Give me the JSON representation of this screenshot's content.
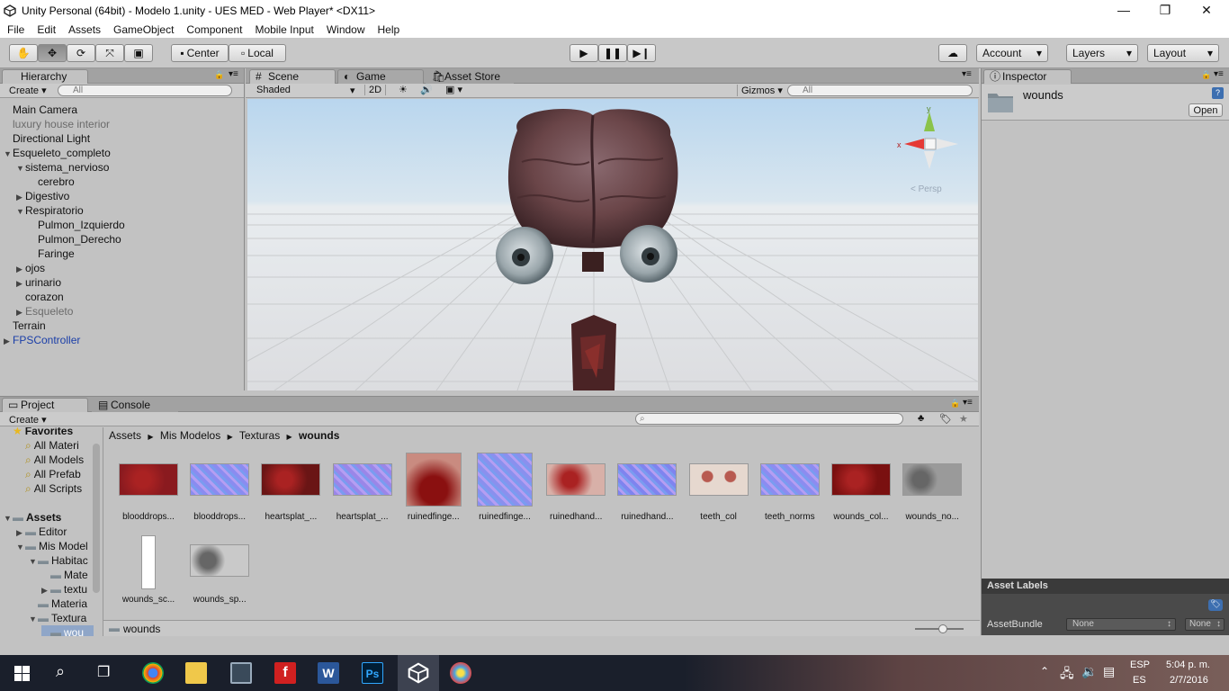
{
  "window": {
    "title": "Unity Personal (64bit) - Modelo 1.unity - UES MED - Web Player* <DX11>",
    "minimize": "—",
    "restore": "❐",
    "close": "✕"
  },
  "menu": [
    "File",
    "Edit",
    "Assets",
    "GameObject",
    "Component",
    "Mobile Input",
    "Window",
    "Help"
  ],
  "toolbar": {
    "center": "Center",
    "local": "Local",
    "account": "Account",
    "layers": "Layers",
    "layout": "Layout"
  },
  "hierarchy": {
    "tab": "Hierarchy",
    "create": "Create",
    "search_placeholder": "All",
    "items": [
      {
        "label": "Main Camera",
        "indent": 0,
        "arrow": "",
        "style": ""
      },
      {
        "label": "luxury house interior",
        "indent": 0,
        "arrow": "",
        "style": "grey"
      },
      {
        "label": "Directional Light",
        "indent": 0,
        "arrow": "",
        "style": ""
      },
      {
        "label": "Esqueleto_completo",
        "indent": 0,
        "arrow": "▼",
        "style": ""
      },
      {
        "label": "sistema_nervioso",
        "indent": 1,
        "arrow": "▼",
        "style": ""
      },
      {
        "label": "cerebro",
        "indent": 2,
        "arrow": "",
        "style": ""
      },
      {
        "label": "Digestivo",
        "indent": 1,
        "arrow": "▶",
        "style": ""
      },
      {
        "label": "Respiratorio",
        "indent": 1,
        "arrow": "▼",
        "style": ""
      },
      {
        "label": "Pulmon_Izquierdo",
        "indent": 2,
        "arrow": "",
        "style": ""
      },
      {
        "label": "Pulmon_Derecho",
        "indent": 2,
        "arrow": "",
        "style": ""
      },
      {
        "label": "Faringe",
        "indent": 2,
        "arrow": "",
        "style": ""
      },
      {
        "label": "ojos",
        "indent": 1,
        "arrow": "▶",
        "style": ""
      },
      {
        "label": "urinario",
        "indent": 1,
        "arrow": "▶",
        "style": ""
      },
      {
        "label": "corazon",
        "indent": 1,
        "arrow": "",
        "style": ""
      },
      {
        "label": "Esqueleto",
        "indent": 1,
        "arrow": "▶",
        "style": "grey"
      },
      {
        "label": "Terrain",
        "indent": 0,
        "arrow": "",
        "style": ""
      },
      {
        "label": "FPSController",
        "indent": 0,
        "arrow": "▶",
        "style": "blue"
      }
    ]
  },
  "scene": {
    "tabs": [
      "Scene",
      "Game",
      "Asset Store"
    ],
    "shading": "Shaded",
    "mode2d": "2D",
    "gizmos": "Gizmos",
    "search_placeholder": "All",
    "persp": "< Persp",
    "axis_y": "y",
    "axis_x": "x"
  },
  "inspector": {
    "tab": "Inspector",
    "name": "wounds",
    "open": "Open",
    "asset_labels": "Asset Labels",
    "asset_bundle": "AssetBundle",
    "bundle_value": "None",
    "bundle_variant": "None"
  },
  "project": {
    "tabs": [
      "Project",
      "Console"
    ],
    "create": "Create",
    "tree": [
      {
        "label": "Favorites",
        "indent": 0,
        "icon": "star",
        "bold": true
      },
      {
        "label": "All Materi",
        "indent": 1,
        "icon": "search"
      },
      {
        "label": "All Models",
        "indent": 1,
        "icon": "search"
      },
      {
        "label": "All Prefab",
        "indent": 1,
        "icon": "search"
      },
      {
        "label": "All Scripts",
        "indent": 1,
        "icon": "search"
      },
      {
        "label": "",
        "indent": 0,
        "icon": ""
      },
      {
        "label": "Assets",
        "indent": 0,
        "icon": "folder",
        "bold": true,
        "arrow": "▼"
      },
      {
        "label": "Editor",
        "indent": 1,
        "icon": "folder",
        "arrow": "▶"
      },
      {
        "label": "Mis Model",
        "indent": 1,
        "icon": "folder",
        "arrow": "▼"
      },
      {
        "label": "Habitac",
        "indent": 2,
        "icon": "folder",
        "arrow": "▼"
      },
      {
        "label": "Mate",
        "indent": 3,
        "icon": "folder"
      },
      {
        "label": "textu",
        "indent": 3,
        "icon": "folder",
        "arrow": "▶"
      },
      {
        "label": "Materia",
        "indent": 2,
        "icon": "folder"
      },
      {
        "label": "Textura",
        "indent": 2,
        "icon": "folder",
        "arrow": "▼"
      },
      {
        "label": "wou",
        "indent": 3,
        "icon": "folder",
        "selected": true
      }
    ],
    "breadcrumb": [
      "Assets",
      "Mis Modelos",
      "Texturas",
      "wounds"
    ],
    "footer_path": "wounds",
    "assets": [
      {
        "name": "blooddrops...",
        "color": "#8a1a1f",
        "type": "blood"
      },
      {
        "name": "blooddrops...",
        "color": "#8a8cf0",
        "type": "normal"
      },
      {
        "name": "heartsplat_...",
        "color": "#6a1515",
        "type": "blood"
      },
      {
        "name": "heartsplat_...",
        "color": "#9a86e8",
        "type": "normal"
      },
      {
        "name": "ruinedfinge...",
        "color": "#c98b80",
        "type": "tall"
      },
      {
        "name": "ruinedfinge...",
        "color": "#8a90ee",
        "type": "tallnormal"
      },
      {
        "name": "ruinedhand...",
        "color": "#d8b0a8",
        "type": "blood"
      },
      {
        "name": "ruinedhand...",
        "color": "#7f84ef",
        "type": "normal"
      },
      {
        "name": "teeth_col",
        "color": "#e6d8cf",
        "type": "teeth"
      },
      {
        "name": "teeth_norms",
        "color": "#8c8cf0",
        "type": "normal"
      },
      {
        "name": "wounds_col...",
        "color": "#7a1010",
        "type": "blood"
      },
      {
        "name": "wounds_no...",
        "color": "#9a9a9a",
        "type": "grey"
      },
      {
        "name": "wounds_sc...",
        "color": "#ffffff",
        "type": "white"
      },
      {
        "name": "wounds_sp...",
        "color": "#c9c9c9",
        "type": "grey"
      }
    ]
  },
  "taskbar": {
    "lang1": "ESP",
    "lang2": "ES",
    "time": "5:04 p. m.",
    "date": "2/7/2016"
  }
}
